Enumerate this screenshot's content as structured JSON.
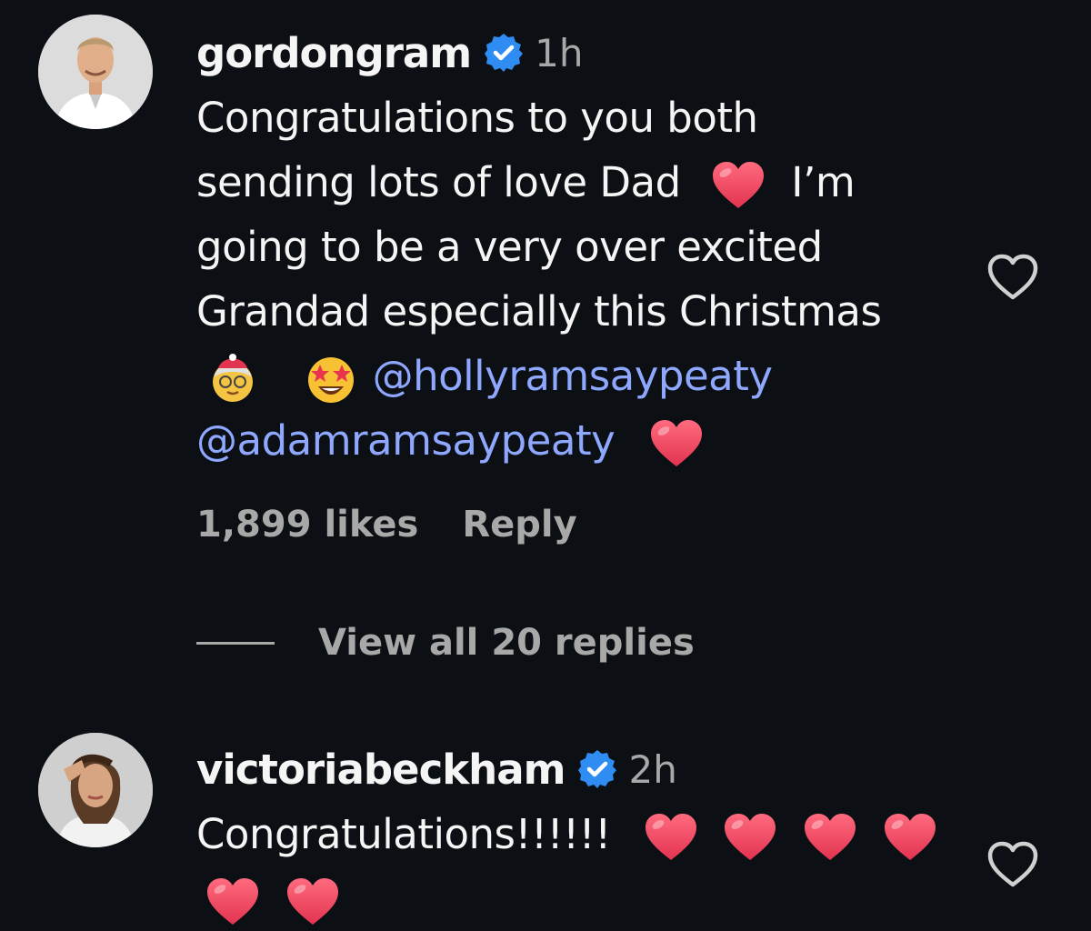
{
  "comments": [
    {
      "username": "gordongram",
      "time": "1h",
      "text_lines": [
        "Congratulations to you both",
        "sending lots of love Dad",
        "I’m",
        "going to be a very over excited",
        "Grandad especially this Christmas",
        "@hollyramsaypeaty",
        "@adamramsaypeaty"
      ],
      "likes": "1,899 likes",
      "reply_label": "Reply",
      "view_replies": "View all 20 replies",
      "icons": [
        "verified-badge",
        "red-heart-emoji",
        "mrs-claus-emoji",
        "star-struck-emoji",
        "heart-outline-icon"
      ]
    },
    {
      "username": "victoriabeckham",
      "time": "2h",
      "text_lines": [
        "Congratulations!!!!!!"
      ],
      "icons": [
        "verified-badge",
        "red-heart-emoji",
        "heart-outline-icon"
      ]
    }
  ],
  "colors": {
    "background": "#0c0f14",
    "mention": "#8fa8ff",
    "verified": "#2f8cf2",
    "heart": "#f0405a"
  }
}
